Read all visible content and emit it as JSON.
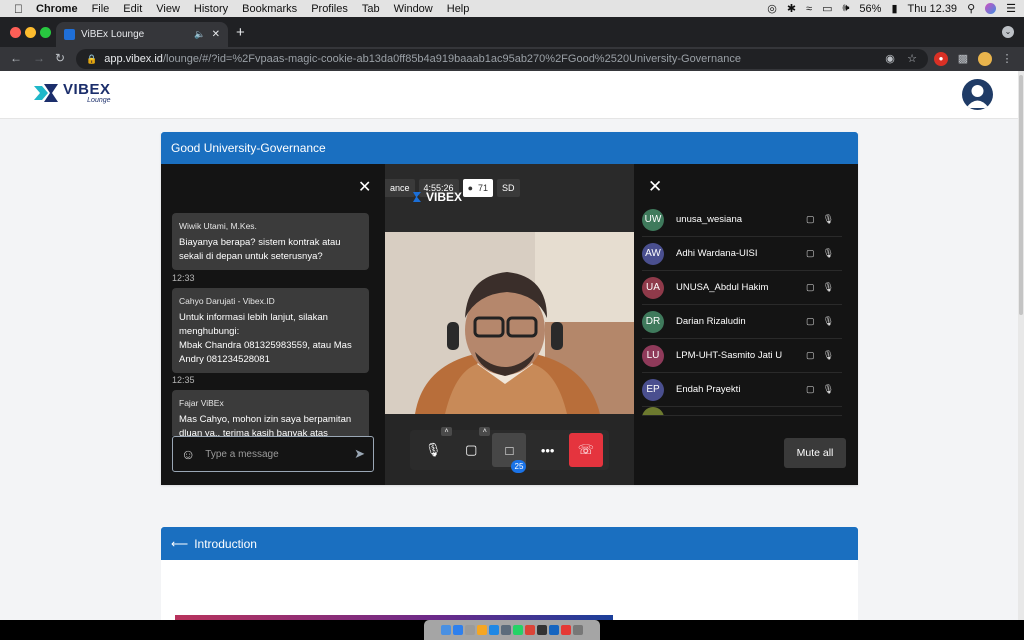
{
  "macos": {
    "apple": "",
    "app": "Chrome",
    "menus": [
      "File",
      "Edit",
      "View",
      "History",
      "Bookmarks",
      "Profiles",
      "Tab",
      "Window",
      "Help"
    ],
    "battery": "56%",
    "clock": "Thu 12.39"
  },
  "browser": {
    "tab_title": "ViBEx Lounge",
    "new_tab": "+",
    "url_host": "app.vibex.id",
    "url_path": "/lounge/#/?id=%2Fvpaas-magic-cookie-ab13da0ff85b4a919baaab1ac95ab270%2FGood%2520University-Governance"
  },
  "site": {
    "logo_text": "VIBEX",
    "logo_sub": "Lounge"
  },
  "session": {
    "title": "Good University-Governance"
  },
  "chat": {
    "messages": [
      {
        "sender": "Wiwik Utami, M.Kes.",
        "text": "Biayanya berapa? sistem kontrak atau sekali di depan untuk seterusnya?",
        "time": "12:33"
      },
      {
        "sender": "Cahyo Darujati - Vibex.ID",
        "text": "Untuk informasi lebih lanjut, silakan menghubungi:\nMbak Chandra 081325983559, atau Mas Andry 081234528081",
        "time": "12:35"
      },
      {
        "sender": "Fajar ViBEx",
        "text": "Mas Cahyo, mohon izin saya berpamitan dluan ya.. terima kasih banyak atas",
        "time": ""
      }
    ],
    "input_placeholder": "Type a message"
  },
  "video": {
    "room_label": "ance",
    "duration": "4:55:26",
    "participant_count": "71",
    "quality": "SD",
    "watermark": "VIBEX",
    "chat_badge": "25"
  },
  "participants": {
    "list": [
      {
        "initials": "UW",
        "name": "unusa_wesiana",
        "color": "#3f7a5c"
      },
      {
        "initials": "AW",
        "name": "Adhi Wardana-UISI",
        "color": "#4a4f8f"
      },
      {
        "initials": "UA",
        "name": "UNUSA_Abdul Hakim",
        "color": "#8f3a4a"
      },
      {
        "initials": "DR",
        "name": "Darian Rizaludin",
        "color": "#3f7a5c"
      },
      {
        "initials": "LU",
        "name": "LPM-UHT-Sasmito Jati U",
        "color": "#8f3a5a"
      },
      {
        "initials": "EP",
        "name": "Endah Prayekti",
        "color": "#4a4f8f"
      }
    ],
    "mute_all": "Mute all"
  },
  "intro": {
    "title": "Introduction"
  }
}
